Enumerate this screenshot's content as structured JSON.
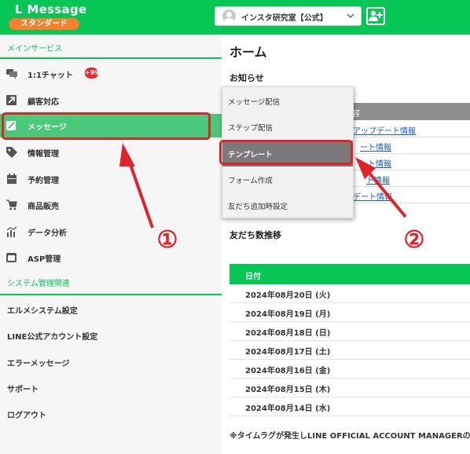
{
  "header": {
    "brand": "L Message",
    "plan": "スタンダード",
    "account_name": "インスタ研究室【公式】",
    "brand_color": "#06c755"
  },
  "sidebar": {
    "main_section": "メインサービス",
    "items": [
      {
        "label": "1:1チャット",
        "icon": "chat-icon",
        "badge": "+99"
      },
      {
        "label": "顧客対応",
        "icon": "arrow-box-icon"
      },
      {
        "label": "メッセージ",
        "icon": "edit-message-icon",
        "active": true
      },
      {
        "label": "情報管理",
        "icon": "tag-icon"
      },
      {
        "label": "予約管理",
        "icon": "calendar-icon"
      },
      {
        "label": "商品販売",
        "icon": "cart-icon"
      },
      {
        "label": "データ分析",
        "icon": "chart-icon"
      },
      {
        "label": "ASP管理",
        "icon": "asp-icon"
      }
    ],
    "system_section": "システム管理関連",
    "system_items": [
      "エルメシステム設定",
      "LINE公式アカウント設定",
      "エラーメッセージ",
      "サポート",
      "ログアウト"
    ]
  },
  "main": {
    "title": "ホーム",
    "notices_heading": "お知らせ",
    "notices_header_fragment": "容",
    "notice_rows": [
      "アップデート情報",
      "ート情報",
      "ート情報",
      "ト情報",
      "デート情報"
    ],
    "friends_heading": "友だち数推移",
    "date_header": "日付",
    "dates": [
      "2024年08月20日 (火)",
      "2024年08月19日 (月)",
      "2024年08月18日 (日)",
      "2024年08月17日 (土)",
      "2024年08月16日 (金)",
      "2024年08月15日 (木)",
      "2024年08月14日 (水)"
    ],
    "footnote": "※タイムラグが発生しLINE OFFICIAL ACCOUNT MANAGERの表"
  },
  "dropdown": {
    "items": [
      "メッセージ配信",
      "ステップ配信",
      "テンプレート",
      "フォーム作成",
      "友だち追加時設定"
    ],
    "active_index": 2
  },
  "annotations": {
    "step1": "①",
    "step2": "②",
    "color": "#d8262a"
  }
}
